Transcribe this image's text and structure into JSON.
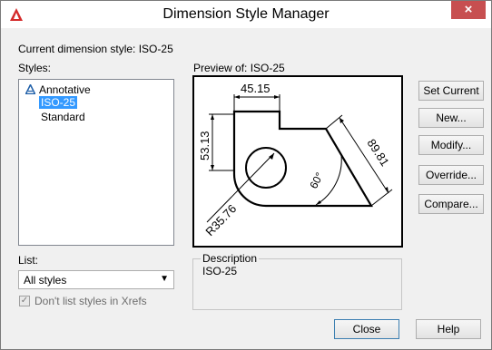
{
  "window": {
    "title": "Dimension Style Manager",
    "close_glyph": "×"
  },
  "current_style_label": "Current dimension style: ISO-25",
  "styles": {
    "label": "Styles:",
    "items": [
      {
        "label": "Annotative",
        "icon": "annotative-icon",
        "selected": false
      },
      {
        "label": "ISO-25",
        "selected": true
      },
      {
        "label": "Standard",
        "selected": false
      }
    ]
  },
  "preview": {
    "label": "Preview of: ISO-25",
    "dims": {
      "top": "45.15",
      "left": "53.13",
      "diag": "89.81",
      "angle": "60°",
      "radius": "R35.76"
    }
  },
  "buttons": {
    "set_current": "Set Current",
    "new": "New...",
    "modify": "Modify...",
    "override": "Override...",
    "compare": "Compare...",
    "close": "Close",
    "help": "Help"
  },
  "list": {
    "label": "List:",
    "selected": "All styles"
  },
  "xref_checkbox": {
    "label": "Don't list styles in Xrefs",
    "checked": true
  },
  "description": {
    "legend": "Description",
    "text": "ISO-25"
  },
  "colors": {
    "accent": "#3399ff",
    "close_red": "#c74f50",
    "icon_red": "#d42a2a"
  }
}
